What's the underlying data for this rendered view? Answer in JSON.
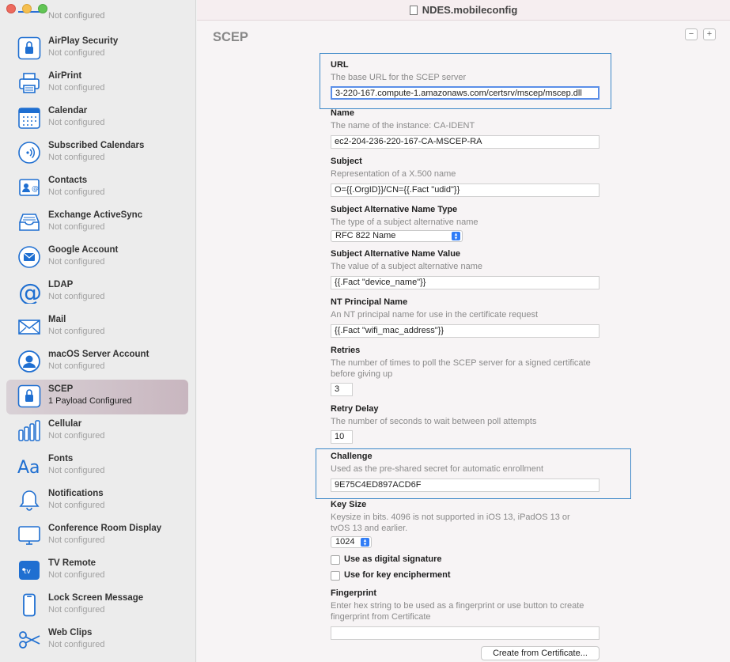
{
  "window": {
    "title": "NDES.mobileconfig"
  },
  "sidebar": {
    "cut_off_subtitle": "Not configured",
    "items": [
      {
        "title": "AirPlay Security",
        "subtitle": "Not configured",
        "icon": "lock-icon"
      },
      {
        "title": "AirPrint",
        "subtitle": "Not configured",
        "icon": "printer-icon"
      },
      {
        "title": "Calendar",
        "subtitle": "Not configured",
        "icon": "calendar-icon"
      },
      {
        "title": "Subscribed Calendars",
        "subtitle": "Not configured",
        "icon": "broadcast-icon"
      },
      {
        "title": "Contacts",
        "subtitle": "Not configured",
        "icon": "contacts-icon"
      },
      {
        "title": "Exchange ActiveSync",
        "subtitle": "Not configured",
        "icon": "inbox-tray-icon"
      },
      {
        "title": "Google Account",
        "subtitle": "Not configured",
        "icon": "envelope-circle-icon"
      },
      {
        "title": "LDAP",
        "subtitle": "Not configured",
        "icon": "at-sign-icon"
      },
      {
        "title": "Mail",
        "subtitle": "Not configured",
        "icon": "mail-icon"
      },
      {
        "title": "macOS Server Account",
        "subtitle": "Not configured",
        "icon": "person-circle-icon"
      },
      {
        "title": "SCEP",
        "subtitle": "1 Payload Configured",
        "icon": "lock-icon",
        "selected": true
      },
      {
        "title": "Cellular",
        "subtitle": "Not configured",
        "icon": "signal-bars-icon"
      },
      {
        "title": "Fonts",
        "subtitle": "Not configured",
        "icon": "font-icon"
      },
      {
        "title": "Notifications",
        "subtitle": "Not configured",
        "icon": "bell-icon"
      },
      {
        "title": "Conference Room Display",
        "subtitle": "Not configured",
        "icon": "display-icon"
      },
      {
        "title": "TV Remote",
        "subtitle": "Not configured",
        "icon": "apple-tv-icon"
      },
      {
        "title": "Lock Screen Message",
        "subtitle": "Not configured",
        "icon": "phone-icon"
      },
      {
        "title": "Web Clips",
        "subtitle": "Not configured",
        "icon": "scissors-icon"
      }
    ]
  },
  "main": {
    "heading": "SCEP",
    "remove_label": "−",
    "add_label": "+",
    "fields": {
      "url": {
        "label": "URL",
        "desc": "The base URL for the SCEP server",
        "value": "3-220-167.compute-1.amazonaws.com/certsrv/mscep/mscep.dll"
      },
      "name": {
        "label": "Name",
        "desc": "The name of the instance: CA-IDENT",
        "value": "ec2-204-236-220-167-CA-MSCEP-RA"
      },
      "subject": {
        "label": "Subject",
        "desc": "Representation of a X.500 name",
        "value": "O={{.OrgID}}/CN={{.Fact \"udid\"}}"
      },
      "san_type": {
        "label": "Subject Alternative Name Type",
        "desc": "The type of a subject alternative name",
        "value": "RFC 822 Name"
      },
      "san_value": {
        "label": "Subject Alternative Name Value",
        "desc": "The value of a subject alternative name",
        "value": "{{.Fact \"device_name\"}}"
      },
      "nt_principal": {
        "label": "NT Principal Name",
        "desc": "An NT principal name for use in the certificate request",
        "value": "{{.Fact \"wifi_mac_address\"}}"
      },
      "retries": {
        "label": "Retries",
        "desc": "The number of times to poll the SCEP server for a signed certificate before giving up",
        "value": "3"
      },
      "retry_delay": {
        "label": "Retry Delay",
        "desc": "The number of seconds to wait between poll attempts",
        "value": "10"
      },
      "challenge": {
        "label": "Challenge",
        "desc": "Used as the pre-shared secret for automatic enrollment",
        "value": "9E75C4ED897ACD6F"
      },
      "key_size": {
        "label": "Key Size",
        "desc": "Keysize in bits. 4096 is not supported in iOS 13, iPadOS 13 or tvOS 13 and earlier.",
        "value": "1024"
      },
      "digital_signature": {
        "label": "Use as digital signature",
        "checked": false
      },
      "key_encipherment": {
        "label": "Use for key encipherment",
        "checked": false
      },
      "fingerprint": {
        "label": "Fingerprint",
        "desc": "Enter hex string to be used as a fingerprint or use button to create fingerprint from Certificate",
        "value": ""
      },
      "create_btn": {
        "label": "Create from Certificate..."
      }
    }
  }
}
